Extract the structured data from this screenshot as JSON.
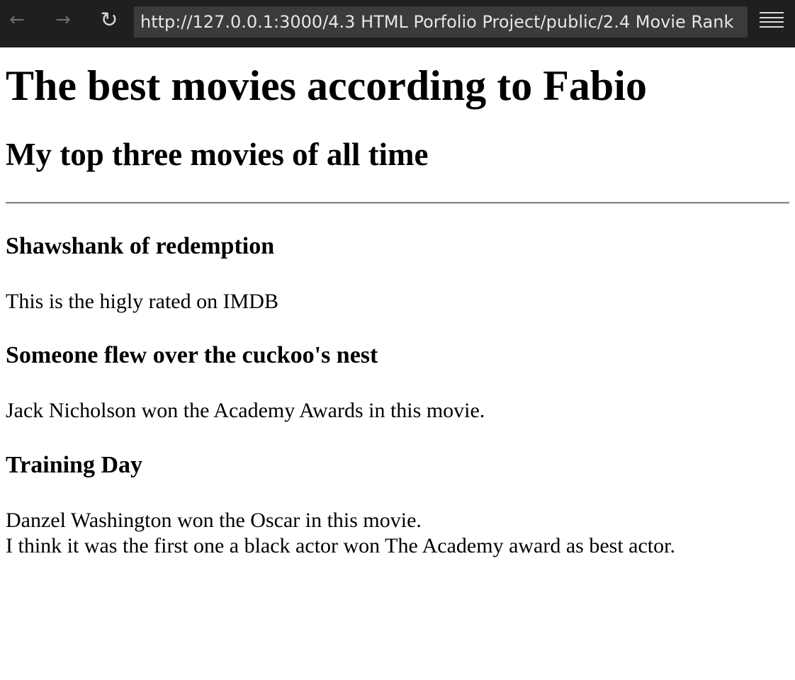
{
  "browser": {
    "back_icon": "←",
    "forward_icon": "→",
    "reload_icon": "↻",
    "url": "http://127.0.0.1:3000/4.3 HTML Porfolio Project/public/2.4 Movie Rank"
  },
  "page": {
    "title": "The best movies according to Fabio",
    "subtitle": "My top three movies of all time",
    "movies": [
      {
        "title": "Shawshank of redemption",
        "desc": [
          "This is the higly rated on IMDB"
        ]
      },
      {
        "title": "Someone flew over the cuckoo's nest",
        "desc": [
          "Jack Nicholson won the Academy Awards in this movie."
        ]
      },
      {
        "title": "Training Day",
        "desc": [
          "Danzel Washington won the Oscar in this movie.",
          "I think it was the first one a black actor won The Academy award as best actor."
        ]
      }
    ]
  }
}
